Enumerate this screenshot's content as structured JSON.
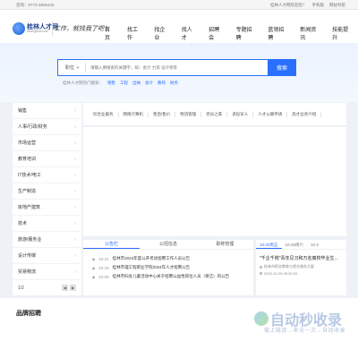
{
  "topbar": {
    "phone": "咨询：0773-2825442",
    "links": [
      "桂林人才网欢迎您！",
      "手机版",
      "网站导航"
    ]
  },
  "header": {
    "logo_text": "桂林人才网",
    "logo_sub": "www.glrcw.com",
    "slogan": "工作，就找我了吧！"
  },
  "nav": {
    "items": [
      "首页",
      "找工作",
      "找企业",
      "找人才",
      "招聘会",
      "专题招聘",
      "蓝领招聘",
      "新闻资讯",
      "技能提升"
    ]
  },
  "search": {
    "type_label": "职位",
    "placeholder": "请输入要搜索的关键字，如：会计 力资 设计师等",
    "button_label": "搜索",
    "hot_label": "桂林人才网热门搜索：",
    "hot_links": [
      "销售",
      "工程",
      "出纳",
      "会计",
      "教师",
      "财务"
    ]
  },
  "sidebar": {
    "items": [
      "销售",
      "人事/行政/财务",
      "市场运营",
      "教育培训",
      "IT技术/电工",
      "生产制造",
      "房地产建筑",
      "技术",
      "旅游/服务业",
      "设计传媒",
      "贸易物流"
    ],
    "page": "1/2"
  },
  "categories": [
    "综合业服务",
    "网络计算机",
    "售后/售价",
    "物流管理",
    "党员之家",
    "退役军人",
    "人才公寓申请",
    "高才业务介绍"
  ],
  "news": {
    "tabs": [
      "公告栏",
      "公招信息",
      "职称管理"
    ],
    "rows": [
      {
        "date": "10-21",
        "title": "桂林市2024年度公开考试招聘工作人员公告"
      },
      {
        "date": "10-18",
        "title": "桂林市理工程职业学院2024年人才招聘公告"
      },
      {
        "date": "10-09",
        "title": "桂林市妇女儿童活动中心关于招聘公益性岗位人员（保洁）的公告"
      }
    ]
  },
  "side_panel": {
    "tabs": [
      "10-20周五",
      "10-26周六",
      "10-2"
    ],
    "title": "\"千企千岗\"青年见习和万名离校毕业生...",
    "location": "桂林市职业教育与就业服务大厦",
    "time": "2024-10-25 09:30:00"
  },
  "brand": {
    "title": "品牌招聘"
  },
  "watermark": {
    "name": "自动秒收录",
    "sub": "做上链接→来访一次→自动收录"
  }
}
